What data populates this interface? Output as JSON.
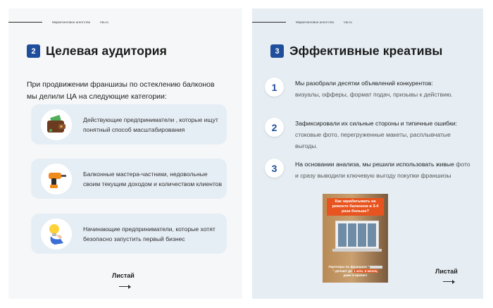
{
  "left_slide": {
    "header": {
      "agency": "Маркетинговое агентство",
      "site": "t4a.ru"
    },
    "number": "2",
    "title": "Целевая аудитория",
    "intro": "При продвижении франшизы по остеклению балконов мы делили ЦА на следующие категории:",
    "cards": [
      {
        "icon": "wallet-money-icon",
        "text": "Действующие предприниматели , которые ищут понятный способ масштабирования"
      },
      {
        "icon": "drill-icon",
        "text": "Балконные мастера-частники, недовольные своим текущим доходом и количеством клиентов"
      },
      {
        "icon": "lightbulb-hand-icon",
        "text": "Начинающие предприниматели, которые хотят безопасно запустить первый бизнес"
      }
    ],
    "swipe_label": "Листай"
  },
  "right_slide": {
    "header": {
      "agency": "Маркетинговое агентство",
      "site": "t4a.ru"
    },
    "number": "3",
    "title": "Эффективные креативы",
    "steps": [
      {
        "number": "1",
        "strong": "Мы разобрали десятки объявлений конкурентов:",
        "muted": "визуалы, офферы, формат подач, призывы к действию."
      },
      {
        "number": "2",
        "strong": "Зафиксировали их сильные стороны и типичные ошибки:",
        "muted": "стоковые фото, перегруженные макеты, расплывчатые выгоды."
      },
      {
        "number": "3",
        "strong": "На основании анализа, мы решили использовать живые",
        "muted": "фото и сразу выводили ключевую выгоду покупки франшизы"
      }
    ],
    "ad": {
      "headline": "Как зарабатывать на ремонте балконов в 3-4 раза больше?",
      "footer_pre": "Партнеры по франшизе \"",
      "footer_brand": "",
      "footer_mid": "\" делают до",
      "footer_highlight": "1 млн. в месяц",
      "footer_post": "даже в кризис!"
    },
    "swipe_label": "Листай"
  },
  "colors": {
    "accent": "#1f4e9c",
    "left_bg": "#f6f7f8",
    "right_bg": "#e6eef4",
    "card_bg": "#e6eef5",
    "ad_orange": "#e8541f"
  }
}
